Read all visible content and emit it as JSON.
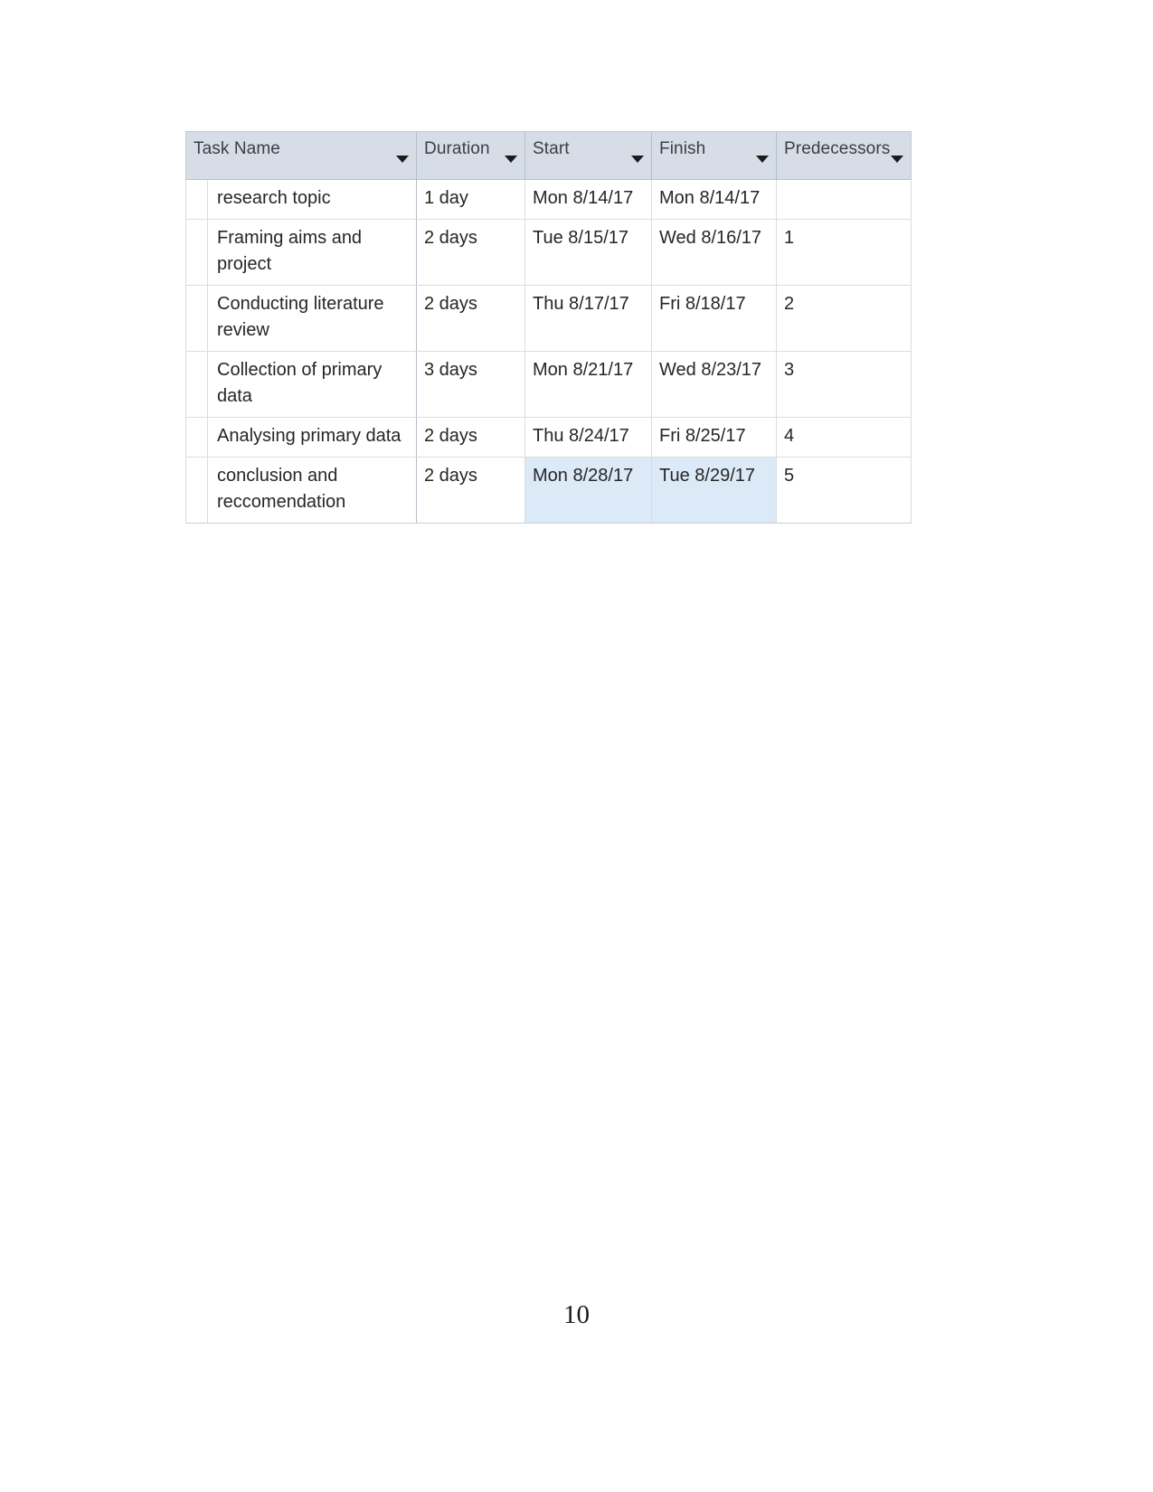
{
  "document": {
    "page_number": "10"
  },
  "table": {
    "columns": [
      {
        "id": "task_name",
        "label": "Task Name",
        "has_filter": true
      },
      {
        "id": "duration",
        "label": "Duration",
        "has_filter": true
      },
      {
        "id": "start",
        "label": "Start",
        "has_filter": true
      },
      {
        "id": "finish",
        "label": "Finish",
        "has_filter": true
      },
      {
        "id": "predecessors",
        "label": "Predecessors",
        "has_filter": true
      }
    ],
    "filter_icon": "chevron-down-icon",
    "highlight_color": "#dce9f7",
    "header_color": "#d6dde6",
    "rows": [
      {
        "task_name": "research topic",
        "duration": "1 day",
        "start": "Mon 8/14/17",
        "finish": "Mon 8/14/17",
        "predecessors": "",
        "selected": false
      },
      {
        "task_name": "Framing aims and project",
        "duration": "2 days",
        "start": "Tue 8/15/17",
        "finish": "Wed 8/16/17",
        "predecessors": "1",
        "selected": false
      },
      {
        "task_name": "Conducting literature review",
        "duration": "2 days",
        "start": "Thu 8/17/17",
        "finish": "Fri 8/18/17",
        "predecessors": "2",
        "selected": false
      },
      {
        "task_name": "Collection of primary data",
        "duration": "3 days",
        "start": "Mon 8/21/17",
        "finish": "Wed 8/23/17",
        "predecessors": "3",
        "selected": false
      },
      {
        "task_name": "Analysing primary data",
        "duration": "2 days",
        "start": "Thu 8/24/17",
        "finish": "Fri 8/25/17",
        "predecessors": "4",
        "selected": false
      },
      {
        "task_name": "conclusion and reccomendation",
        "duration": "2 days",
        "start": "Mon 8/28/17",
        "finish": "Tue 8/29/17",
        "predecessors": "5",
        "selected": true
      }
    ]
  }
}
